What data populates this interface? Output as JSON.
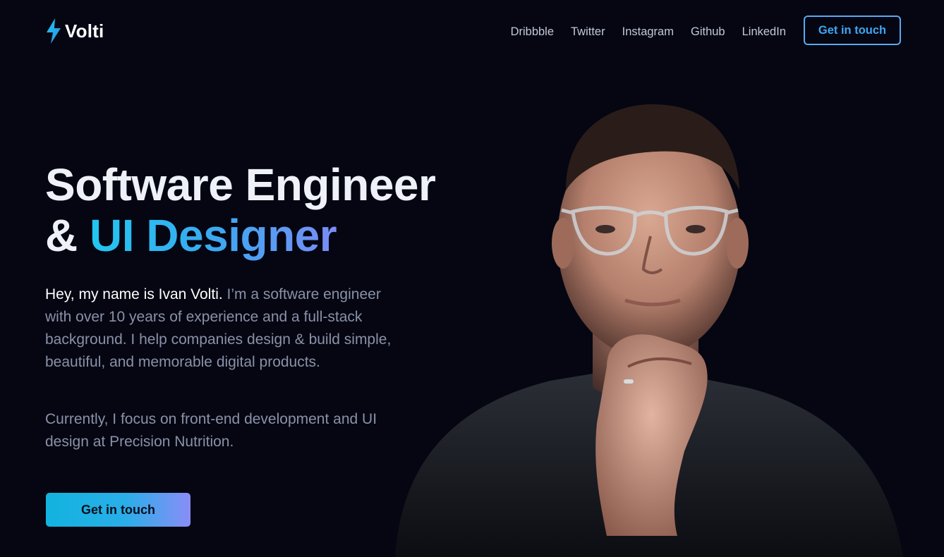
{
  "brand": {
    "name": "Volti",
    "icon": "lightning-bolt-icon",
    "accent": "#22c6ef"
  },
  "nav": {
    "links": [
      "Dribbble",
      "Twitter",
      "Instagram",
      "Github",
      "LinkedIn"
    ],
    "cta_label": "Get in touch"
  },
  "hero": {
    "title_line1": "Software Engineer",
    "title_line2_prefix": "& ",
    "title_line2_highlight": "UI Designer",
    "intro_lead": "Hey, my name is Ivan Volti.",
    "intro_rest": " I’m a software engineer with over 10 years of experience and a full-stack background. I help companies design & build simple, beautiful, and memorable digital products.",
    "focus": "Currently, I focus on front-end development and UI design at Precision Nutrition.",
    "cta_label": "Get in touch"
  },
  "colors": {
    "background": "#050612",
    "gradient_start": "#22c6ef",
    "gradient_end": "#7b8cf6"
  }
}
